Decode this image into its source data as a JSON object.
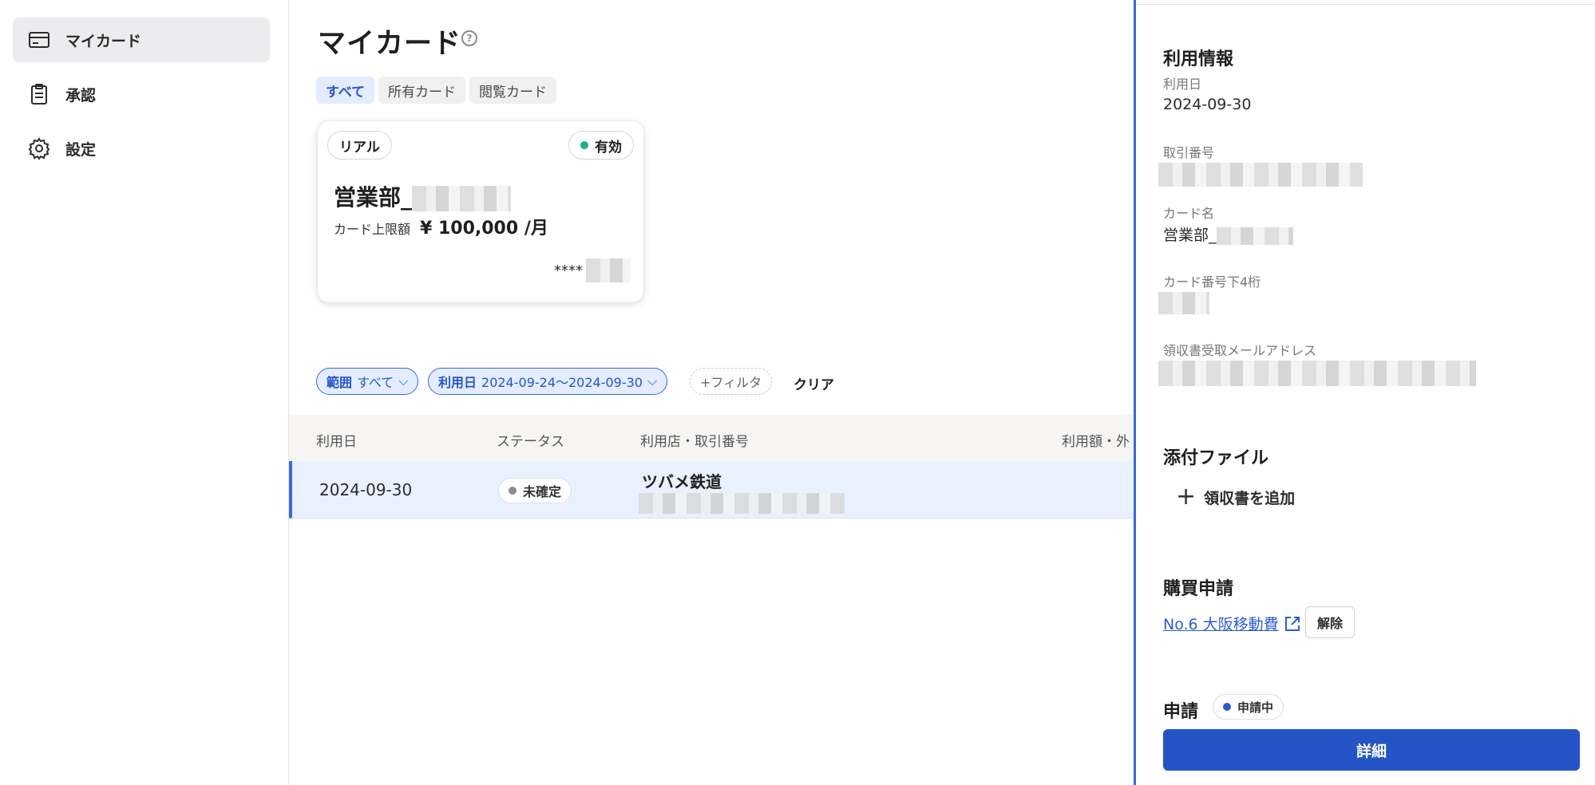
{
  "sidebar": {
    "items": [
      {
        "label": "マイカード",
        "icon": "credit-card-icon",
        "active": true
      },
      {
        "label": "承認",
        "icon": "clipboard-icon",
        "active": false
      },
      {
        "label": "設定",
        "icon": "gear-icon",
        "active": false
      }
    ]
  },
  "main": {
    "title": "マイカード",
    "help_icon": "?",
    "tabs": [
      {
        "label": "すべて",
        "active": true
      },
      {
        "label": "所有カード",
        "active": false
      },
      {
        "label": "閲覧カード",
        "active": false
      }
    ],
    "card": {
      "type_label": "リアル",
      "status_label": "有効",
      "name_prefix": "営業部_",
      "limit_label": "カード上限額",
      "limit_value": "¥ 100,000 /月",
      "masked_prefix": "****"
    },
    "filters": {
      "scope": {
        "key": "範囲",
        "value": "すべて"
      },
      "date": {
        "key": "利用日",
        "value": "2024-09-24〜2024-09-30"
      },
      "add_label": "+フィルタ",
      "clear_label": "クリア"
    },
    "table": {
      "headers": [
        "利用日",
        "ステータス",
        "利用店・取引番号",
        "利用額・外"
      ],
      "rows": [
        {
          "date": "2024-09-30",
          "status": "未確定",
          "shop": "ツバメ鉄道"
        }
      ]
    }
  },
  "panel": {
    "usage_title": "利用情報",
    "usage_date_label": "利用日",
    "usage_date": "2024-09-30",
    "txn_label": "取引番号",
    "card_name_label": "カード名",
    "card_name_prefix": "営業部_",
    "card_last4_label": "カード番号下4桁",
    "receipt_email_label": "領収書受取メールアドレス",
    "attachment_title": "添付ファイル",
    "add_receipt_label": "領収書を追加",
    "purchase_title": "購買申請",
    "purchase_link": "No.6 大阪移動費",
    "unlink_label": "解除",
    "apply_title": "申請",
    "apply_status": "申請中",
    "detail_button": "詳細"
  },
  "colors": {
    "accent": "#2454c6",
    "status_active": "#1db37a",
    "status_pending": "#8c8c8c",
    "status_applying": "#2a5bd7"
  }
}
